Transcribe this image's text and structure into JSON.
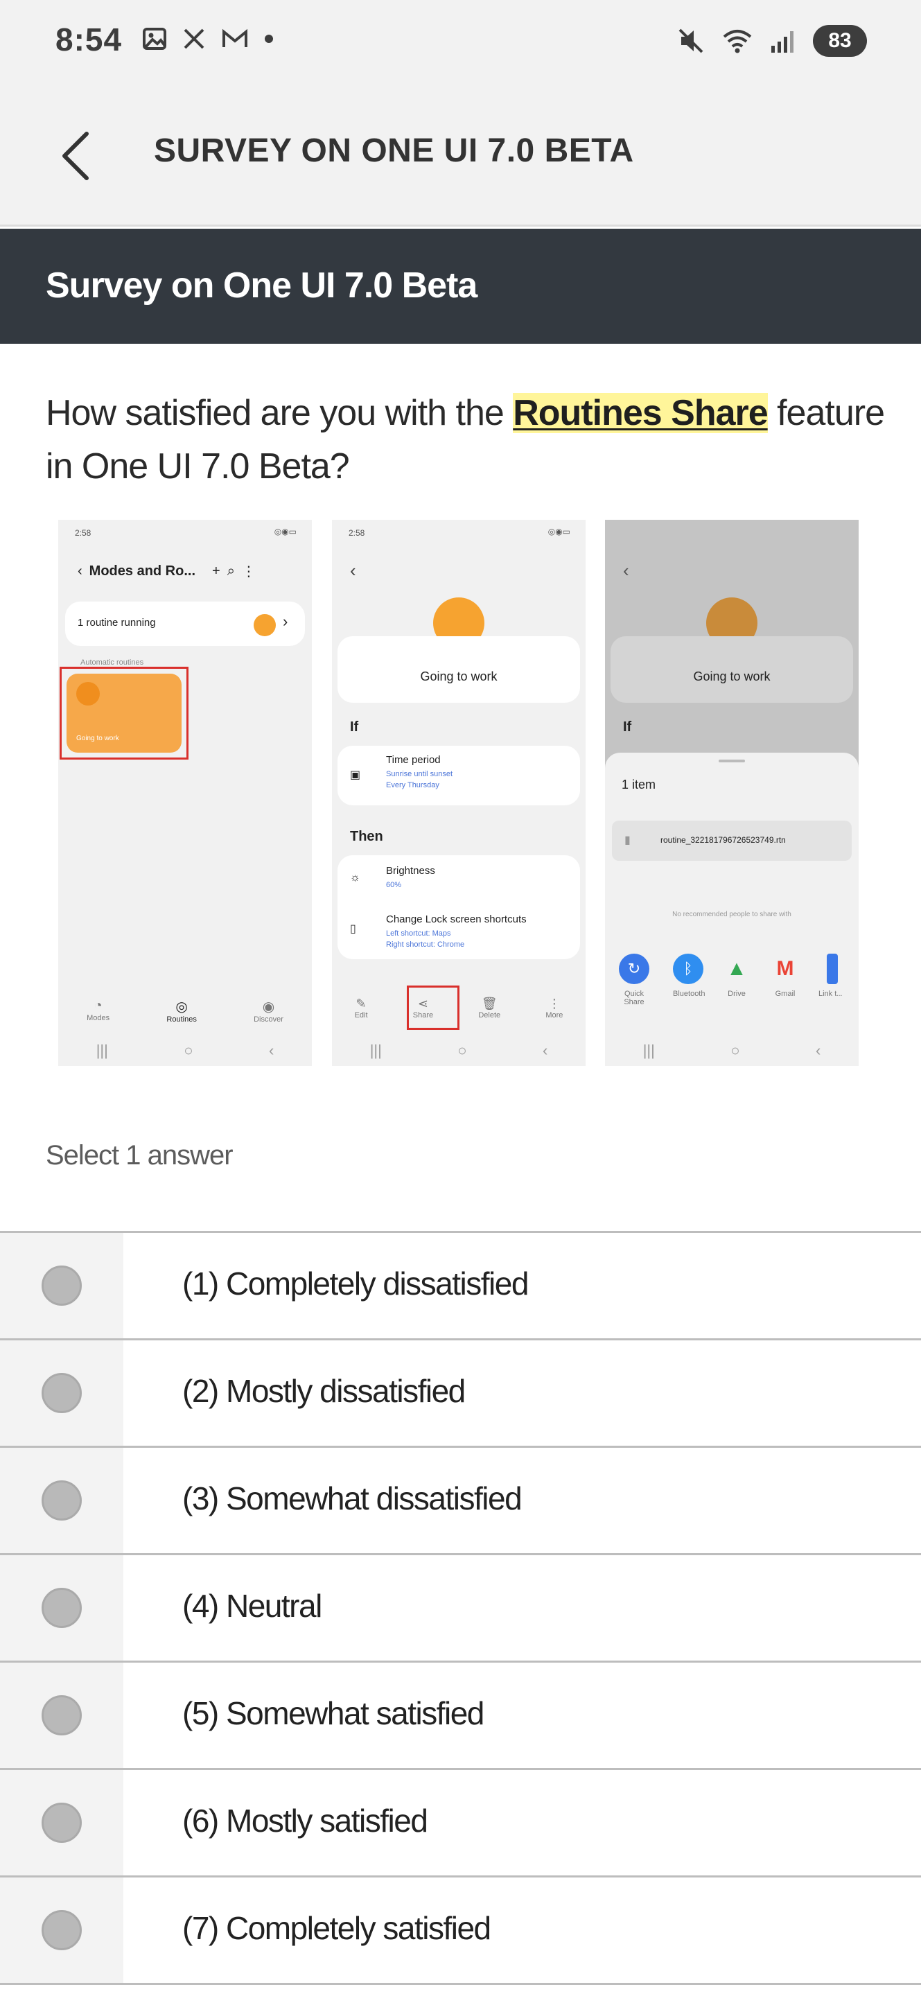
{
  "status_bar": {
    "time": "8:54",
    "battery": "83",
    "network": "6"
  },
  "app_bar": {
    "title": "SURVEY ON ONE UI 7.0 BETA"
  },
  "survey": {
    "header": "Survey on One UI 7.0 Beta",
    "question_prefix": "How satisfied are you with the ",
    "question_highlight": "Routines Share",
    "question_suffix": " feature in One UI 7.0 Beta?",
    "select_label": "Select 1 answer",
    "options": [
      "(1) Completely dissatisfied",
      "(2) Mostly dissatisfied",
      "(3) Somewhat dissatisfied",
      "(4) Neutral",
      "(5) Somewhat satisfied",
      "(6) Mostly satisfied",
      "(7) Completely satisfied"
    ]
  },
  "illustration": {
    "screen1": {
      "time": "2:58",
      "title": "Modes and Ro...",
      "running": "1 routine running",
      "section": "Automatic routines",
      "tile_label": "Going to work",
      "tabs": [
        "Modes",
        "Routines",
        "Discover"
      ]
    },
    "screen2": {
      "time": "2:58",
      "routine_name": "Going to work",
      "if_label": "If",
      "time_period": "Time period",
      "time_period_sub1": "Sunrise until sunset",
      "time_period_sub2": "Every Thursday",
      "then_label": "Then",
      "brightness": "Brightness",
      "brightness_sub": "60%",
      "lock_shortcuts": "Change Lock screen shortcuts",
      "lock_sub1": "Left shortcut: Maps",
      "lock_sub2": "Right shortcut: Chrome",
      "actions": [
        "Edit",
        "Share",
        "Delete",
        "More"
      ]
    },
    "screen3": {
      "routine_name": "Going to work",
      "if_label": "If",
      "item_count": "1 item",
      "file_name": "routine_3221817967265237​49.rtn",
      "no_people": "No recommended people to share with",
      "apps": [
        "Quick Share",
        "Bluetooth",
        "Drive",
        "Gmail",
        "Link t..."
      ]
    }
  },
  "colors": {
    "header_bg": "#333940",
    "highlight": "#fff59a",
    "accent_orange": "#f6a330",
    "radio": "#b9b9b9"
  }
}
